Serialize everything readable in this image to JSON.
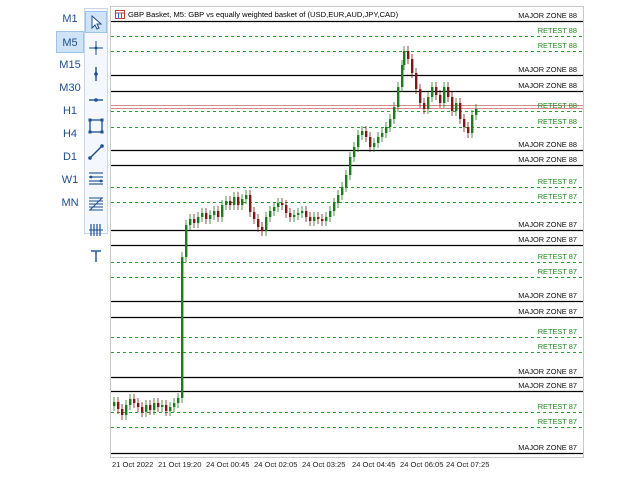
{
  "timeframes": [
    "M1",
    "M5",
    "M15",
    "M30",
    "H1",
    "H4",
    "D1",
    "W1",
    "MN"
  ],
  "active_timeframe": "M5",
  "tools": [
    {
      "name": "cursor-icon",
      "active": true
    },
    {
      "name": "crosshair-icon",
      "active": false
    },
    {
      "name": "vertical-line-icon",
      "active": false
    },
    {
      "name": "horizontal-line-icon",
      "active": false
    },
    {
      "name": "rectangle-icon",
      "active": false
    },
    {
      "name": "trendline-icon",
      "active": false
    },
    {
      "name": "channel-icon",
      "active": false
    },
    {
      "name": "fibonacci-icon",
      "active": false
    },
    {
      "name": "gann-icon",
      "active": false
    },
    {
      "name": "text-icon",
      "active": false
    }
  ],
  "chart": {
    "title": "GBP Basket, M5:  GBP vs equally weighted basket of (USD,EUR,AUD,JPY,CAD)",
    "icon_name": "chart-window-icon"
  },
  "x_labels": [
    "21 Oct 2022",
    "21 Oct 19:20",
    "24 Oct 00:45",
    "24 Oct 02:05",
    "24 Oct 03:25",
    "24 Oct 04:45",
    "24 Oct 06:05",
    "24 Oct 07:25"
  ],
  "zones": [
    {
      "type": "major",
      "label": "MAJOR ZONE  88"
    },
    {
      "type": "retest",
      "label": "RETEST  88"
    },
    {
      "type": "retest",
      "label": "RETEST  88"
    },
    {
      "type": "major",
      "label": "MAJOR ZONE  88"
    },
    {
      "type": "major",
      "label": "MAJOR ZONE  88"
    },
    {
      "type": "retest",
      "label": "RETEST  88"
    },
    {
      "type": "retest",
      "label": "RETEST  88"
    },
    {
      "type": "major",
      "label": "MAJOR ZONE  88"
    },
    {
      "type": "major",
      "label": "MAJOR ZONE  88"
    },
    {
      "type": "retest",
      "label": "RETEST  87"
    },
    {
      "type": "retest",
      "label": "RETEST  87"
    },
    {
      "type": "major",
      "label": "MAJOR ZONE  87"
    },
    {
      "type": "major",
      "label": "MAJOR ZONE  87"
    },
    {
      "type": "retest",
      "label": "RETEST  87"
    },
    {
      "type": "retest",
      "label": "RETEST  87"
    },
    {
      "type": "major",
      "label": "MAJOR ZONE  87"
    },
    {
      "type": "major",
      "label": "MAJOR ZONE  87"
    },
    {
      "type": "retest",
      "label": "RETEST  87"
    },
    {
      "type": "retest",
      "label": "RETEST  87"
    },
    {
      "type": "major",
      "label": "MAJOR ZONE  87"
    },
    {
      "type": "major",
      "label": "MAJOR ZONE  87"
    },
    {
      "type": "retest",
      "label": "RETEST  87"
    },
    {
      "type": "retest",
      "label": "RETEST  87"
    },
    {
      "type": "major",
      "label": "MAJOR ZONE  87"
    }
  ],
  "colors": {
    "major_line": "#000000",
    "retest_line": "#2e9a2e",
    "bull_candle": "#1f7a1f",
    "bear_candle": "#7a1a1a",
    "price_line": "#d88a8a",
    "accent": "#1b4f8f"
  }
}
